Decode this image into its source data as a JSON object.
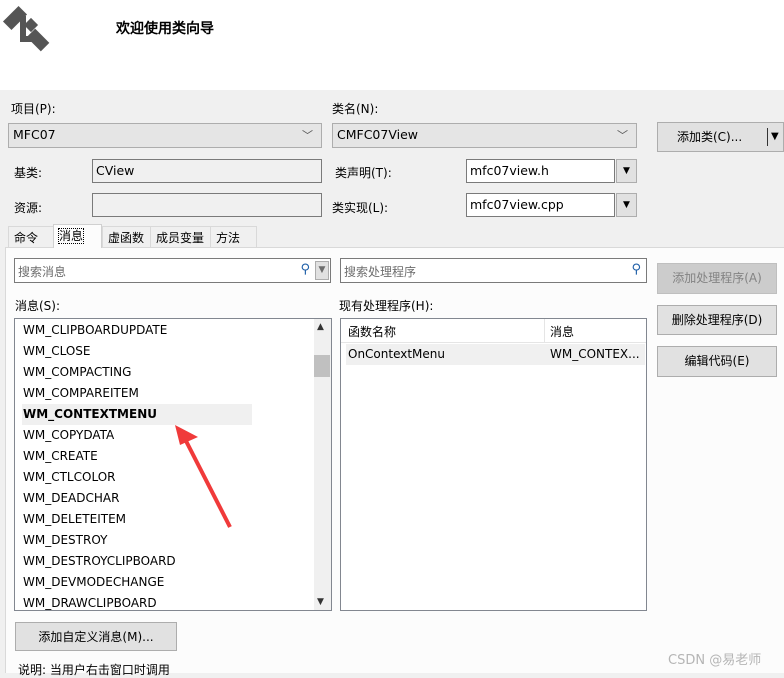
{
  "header": {
    "title": "欢迎使用类向导",
    "logo_icon": "class-wizard-icon"
  },
  "project": {
    "label": "项目(P):",
    "value": "MFC07"
  },
  "class_name": {
    "label": "类名(N):",
    "value": "CMFC07View"
  },
  "add_class_button": "添加类(C)...",
  "base_class": {
    "label": "基类:",
    "value": "CView"
  },
  "class_decl": {
    "label": "类声明(T):",
    "value": "mfc07view.h"
  },
  "resource": {
    "label": "资源:",
    "value": ""
  },
  "class_impl": {
    "label": "类实现(L):",
    "value": "mfc07view.cpp"
  },
  "tabs": [
    {
      "label": "命令"
    },
    {
      "label": "消息"
    },
    {
      "label": "虚函数"
    },
    {
      "label": "成员变量"
    },
    {
      "label": "方法"
    }
  ],
  "search_messages": {
    "placeholder": "搜索消息"
  },
  "search_handlers": {
    "placeholder": "搜索处理程序"
  },
  "messages_label": "消息(S):",
  "handlers_label": "现有处理程序(H):",
  "messages": [
    "WM_CLIPBOARDUPDATE",
    "WM_CLOSE",
    "WM_COMPACTING",
    "WM_COMPAREITEM",
    "WM_CONTEXTMENU",
    "WM_COPYDATA",
    "WM_CREATE",
    "WM_CTLCOLOR",
    "WM_DEADCHAR",
    "WM_DELETEITEM",
    "WM_DESTROY",
    "WM_DESTROYCLIPBOARD",
    "WM_DEVMODECHANGE",
    "WM_DRAWCLIPBOARD"
  ],
  "selected_message": "WM_CONTEXTMENU",
  "handlers_table": {
    "columns": [
      "函数名称",
      "消息"
    ],
    "rows": [
      [
        "OnContextMenu",
        "WM_CONTEX..."
      ]
    ]
  },
  "buttons": {
    "add_handler": "添加处理程序(A)",
    "delete_handler": "删除处理程序(D)",
    "edit_code": "编辑代码(E)",
    "add_custom": "添加自定义消息(M)..."
  },
  "description": "说明:  当用户右击窗口时调用",
  "watermark": "CSDN @易老师",
  "colors": {
    "arrow": "#f03a3a"
  }
}
